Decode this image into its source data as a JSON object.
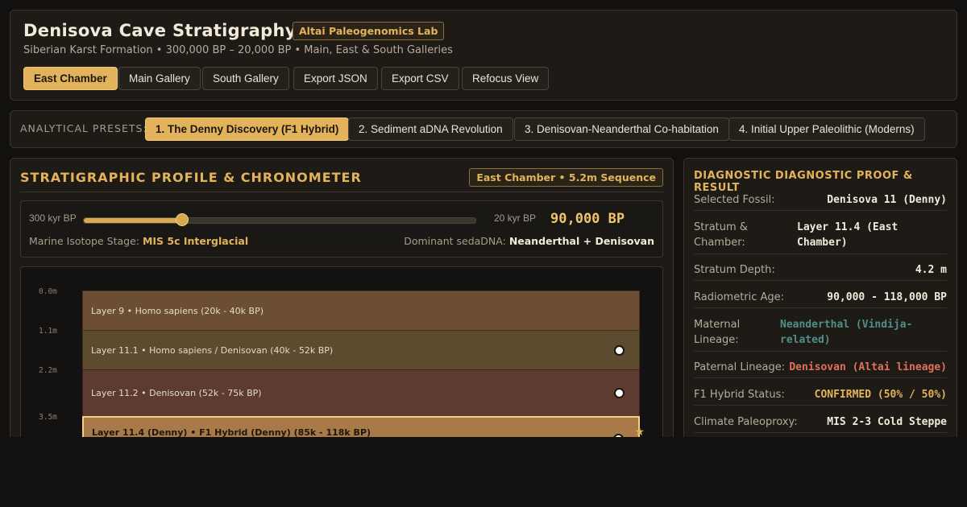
{
  "header": {
    "title": "Denisova Cave Stratigraphy",
    "lab_badge": "Altai Paleogenomics Lab",
    "subtitle": "Siberian Karst Formation • 300,000 BP – 20,000 BP • Main, East & South Galleries",
    "chambers": [
      "East Chamber",
      "Main Gallery",
      "South Gallery"
    ],
    "active_chamber": "East Chamber",
    "actions": [
      "Export JSON",
      "Export CSV",
      "Refocus View"
    ]
  },
  "presets": {
    "label": "ANALYTICAL PRESETS:",
    "items": [
      "1. The Denny Discovery (F1 Hybrid)",
      "2. Sediment aDNA Revolution",
      "3. Denisovan-Neanderthal Co-habitation",
      "4. Initial Upper Paleolithic (Moderns)"
    ],
    "active_index": 0
  },
  "profile": {
    "title": "STRATIGRAPHIC PROFILE & CHRONOMETER",
    "sequence_badge": "East Chamber • 5.2m Sequence",
    "chronometer": {
      "min_label": "300 kyr BP",
      "max_label": "20 kyr BP",
      "current_age": "90,000 BP",
      "slider_fraction": 0.25,
      "mis_label": "Marine Isotope Stage:",
      "mis_value": "MIS 5c Interglacial",
      "dna_label": "Dominant sedaDNA:",
      "dna_value": "Neanderthal + Denisovan"
    },
    "depth_ticks": [
      "0.0m",
      "1.1m",
      "2.2m",
      "3.5m"
    ],
    "layers": [
      {
        "label": "Layer 9 • Homo sapiens (20k - 40k BP)",
        "color": "#6c4f33",
        "has_marker": false,
        "selected": false
      },
      {
        "label": "Layer 11.1 • Homo sapiens / Denisovan (40k - 52k BP)",
        "color": "#5d4a2f",
        "has_marker": true,
        "selected": false
      },
      {
        "label": "Layer 11.2 • Denisovan (52k - 75k BP)",
        "color": "#5e3b2f",
        "has_marker": true,
        "selected": false
      },
      {
        "label": "Layer 11.4 (Denny) • F1 Hybrid (Denny) (85k - 118k BP)",
        "color": "#a87a47",
        "has_marker": true,
        "selected": true
      }
    ]
  },
  "diagnostic": {
    "title": "DIAGNOSTIC DIAGNOSTIC PROOF & RESULT",
    "rows": [
      {
        "key": "Selected Fossil:",
        "value": "Denisova 11 (Denny)",
        "color": "#f2ead9"
      },
      {
        "key": "Stratum & Chamber:",
        "value": "Layer 11.4 (East Chamber)",
        "color": "#f2ead9"
      },
      {
        "key": "Stratum Depth:",
        "value": "4.2 m",
        "color": "#f2ead9"
      },
      {
        "key": "Radiometric Age:",
        "value": "90,000 - 118,000 BP",
        "color": "#f2ead9"
      },
      {
        "key": "Maternal Lineage:",
        "value": "Neanderthal (Vindija-related)",
        "color": "#4f8f86"
      },
      {
        "key": "Paternal Lineage:",
        "value": "Denisovan (Altai lineage)",
        "color": "#e0705a"
      },
      {
        "key": "F1 Hybrid Status:",
        "value": "CONFIRMED (50% / 50%)",
        "color": "#e2b35a"
      },
      {
        "key": "Climate Paleoproxy:",
        "value": "MIS 2-3 Cold Steppe",
        "color": "#f2ead9"
      }
    ]
  }
}
